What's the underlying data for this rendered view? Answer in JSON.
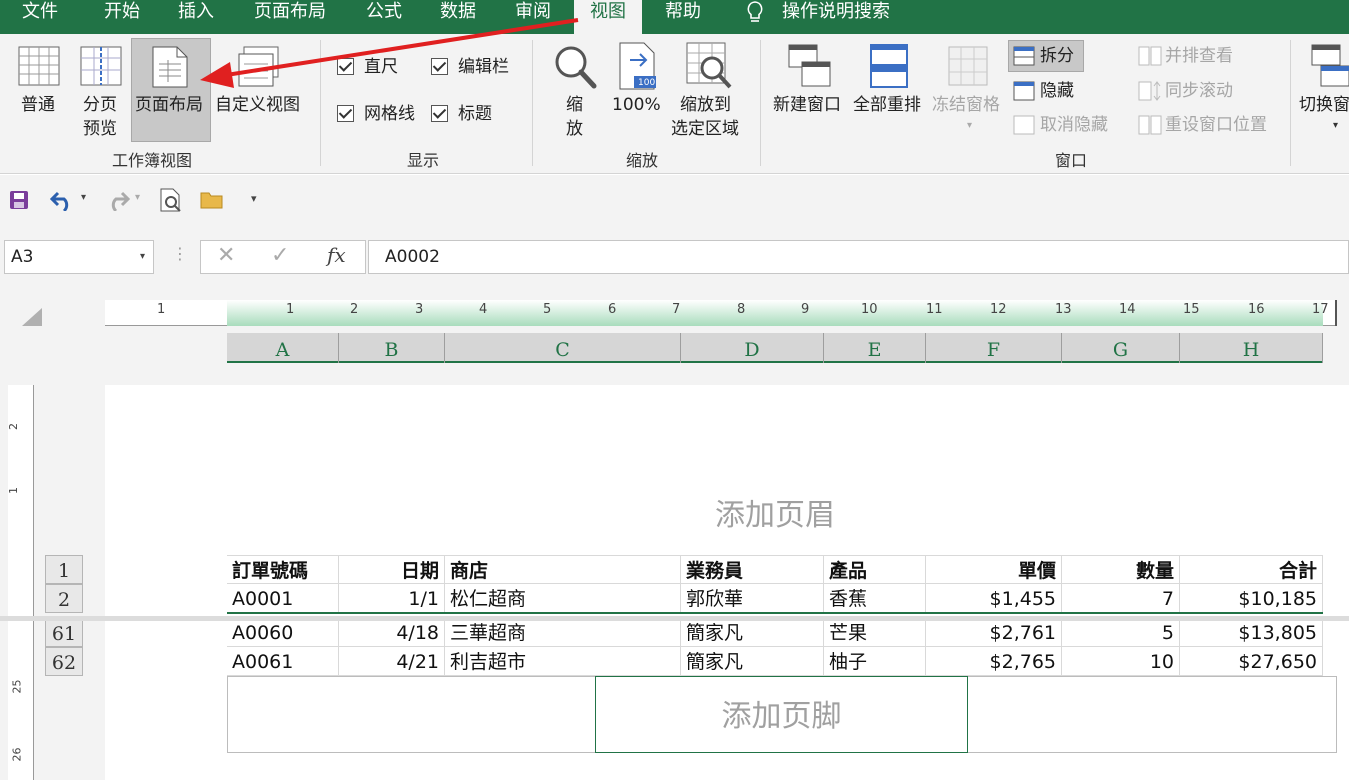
{
  "tabs": [
    {
      "label": "文件",
      "active": false
    },
    {
      "label": "开始",
      "active": false
    },
    {
      "label": "插入",
      "active": false
    },
    {
      "label": "页面布局",
      "active": false
    },
    {
      "label": "公式",
      "active": false
    },
    {
      "label": "数据",
      "active": false
    },
    {
      "label": "审阅",
      "active": false
    },
    {
      "label": "视图",
      "active": true
    },
    {
      "label": "帮助",
      "active": false
    },
    {
      "label": "操作说明搜索",
      "active": false
    }
  ],
  "ribbon": {
    "workbook_views": {
      "group_name": "工作簿视图",
      "normal": "普通",
      "page_break_1": "分页",
      "page_break_2": "预览",
      "page_layout": "页面布局",
      "custom_views": "自定义视图"
    },
    "show": {
      "group_name": "显示",
      "ruler": "直尺",
      "formula_bar": "编辑栏",
      "gridlines": "网格线",
      "headings": "标题"
    },
    "zoom": {
      "group_name": "缩放",
      "zoom_1": "缩",
      "zoom_2": "放",
      "zoom_100": "100%",
      "zoom_100_badge": "100",
      "zoom_sel_1": "缩放到",
      "zoom_sel_2": "选定区域"
    },
    "window": {
      "group_name": "窗口",
      "new_window": "新建窗口",
      "arrange_all": "全部重排",
      "freeze_panes": "冻结窗格",
      "split": "拆分",
      "hide": "隐藏",
      "unhide": "取消隐藏",
      "side_by_side": "并排查看",
      "sync_scroll": "同步滚动",
      "reset_position": "重设窗口位置",
      "switch_windows": "切换窗"
    }
  },
  "name_box": "A3",
  "formula_value": "A0002",
  "fx_label": "fx",
  "ruler_numbers": [
    "1",
    "1",
    "2",
    "3",
    "4",
    "5",
    "6",
    "7",
    "8",
    "9",
    "10",
    "11",
    "12",
    "13",
    "14",
    "15",
    "16",
    "17"
  ],
  "columns": [
    "A",
    "B",
    "C",
    "D",
    "E",
    "F",
    "G",
    "H"
  ],
  "vruler_numbers": [
    "2",
    "1",
    "25",
    "26"
  ],
  "header_placeholder": "添加页眉",
  "footer_placeholder": "添加页脚",
  "table": {
    "headers": [
      "訂單號碼",
      "日期",
      "商店",
      "業務員",
      "產品",
      "單價",
      "數量",
      "合計"
    ],
    "rows": [
      {
        "row": "1",
        "cells": [
          "訂單號碼",
          "日期",
          "商店",
          "業務員",
          "產品",
          "單價",
          "數量",
          "合計"
        ]
      },
      {
        "row": "2",
        "cells": [
          "A0001",
          "1/1",
          "松仁超商",
          "郭欣華",
          "香蕉",
          "$1,455",
          "7",
          "$10,185"
        ]
      },
      {
        "row": "61",
        "cells": [
          "A0060",
          "4/18",
          "三華超商",
          "簡家凡",
          "芒果",
          "$2,761",
          "5",
          "$13,805"
        ]
      },
      {
        "row": "62",
        "cells": [
          "A0061",
          "4/21",
          "利吉超市",
          "簡家凡",
          "柚子",
          "$2,765",
          "10",
          "$27,650"
        ]
      }
    ]
  },
  "colors": {
    "accent": "#217346",
    "annotation_arrow": "#e02020"
  }
}
